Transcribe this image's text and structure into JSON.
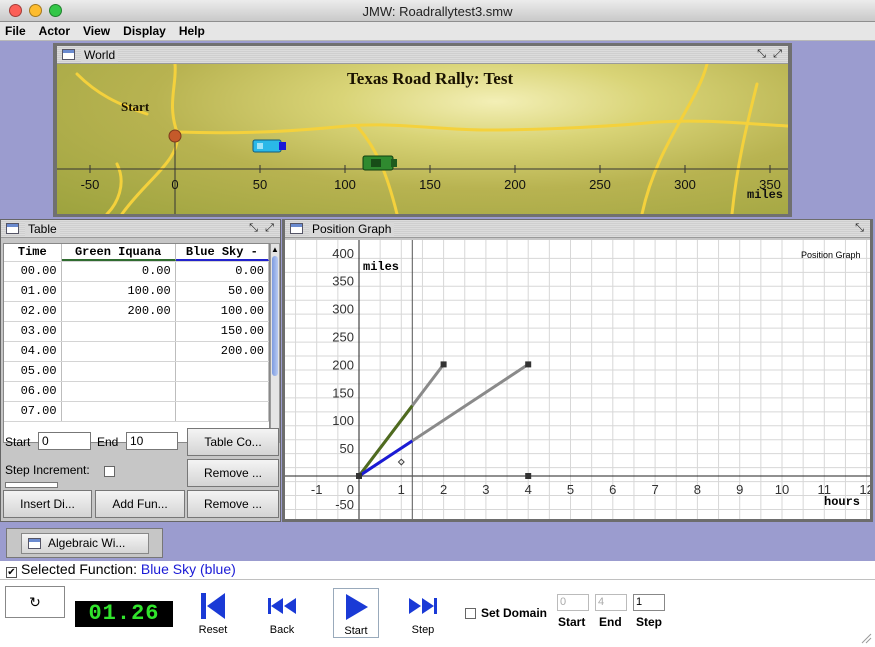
{
  "window": {
    "title": "JMW: Roadrallytest3.smw",
    "light_colors": [
      "#fc5f57",
      "#fdbc2e",
      "#33c748"
    ]
  },
  "menu": [
    "File",
    "Actor",
    "View",
    "Display",
    "Help"
  ],
  "world": {
    "frame_title": "World",
    "map_title": "Texas Road Rally: Test",
    "start_label": "Start",
    "axis_ticks": [
      "-50",
      "0",
      "50",
      "100",
      "150",
      "200",
      "250",
      "300",
      "350"
    ],
    "axis_unit": "miles"
  },
  "table": {
    "frame_title": "Table",
    "headers": [
      "Time",
      "Green Iquana",
      "Blue Sky -"
    ],
    "rows": [
      [
        "00.00",
        "0.00",
        "0.00"
      ],
      [
        "01.00",
        "100.00",
        "50.00"
      ],
      [
        "02.00",
        "200.00",
        "100.00"
      ],
      [
        "03.00",
        "",
        "150.00"
      ],
      [
        "04.00",
        "",
        "200.00"
      ],
      [
        "05.00",
        "",
        ""
      ],
      [
        "06.00",
        "",
        ""
      ],
      [
        "07.00",
        "",
        ""
      ]
    ],
    "start_label": "Start",
    "start_value": "0",
    "end_label": "End",
    "end_value": "10",
    "step_label": "Step Increment:",
    "btn_table_co": "Table Co...",
    "btn_remove1": "Remove ...",
    "btn_remove2": "Remove ...",
    "btn_insert": "Insert Di...",
    "btn_addfun": "Add Fun..."
  },
  "graph": {
    "frame_title": "Position Graph",
    "corner_label": "Position Graph",
    "y_unit": "miles",
    "x_unit": "hours",
    "x_ticks": [
      "-1",
      "1",
      "2",
      "3",
      "4",
      "5",
      "6",
      "7",
      "8",
      "9",
      "10",
      "11",
      "12"
    ],
    "y_ticks": [
      "400",
      "350",
      "300",
      "250",
      "200",
      "150",
      "100",
      "50",
      "-50"
    ],
    "zero_label": "0",
    "colors": {
      "green": "#4f6b1f",
      "blue": "#1a1ad6",
      "gray": "#8a8a8a"
    }
  },
  "chart_data": {
    "type": "line",
    "title": "Position Graph",
    "xlabel": "hours",
    "ylabel": "miles",
    "xlim": [
      -1.5,
      12.3
    ],
    "ylim": [
      -65,
      410
    ],
    "current_time": 1.26,
    "series": [
      {
        "name": "Green Iquana",
        "x": [
          0,
          2
        ],
        "y": [
          0,
          200
        ]
      },
      {
        "name": "Blue Sky",
        "x": [
          0,
          4
        ],
        "y": [
          0,
          200
        ]
      }
    ]
  },
  "algebraic": {
    "label": "Algebraic Wi..."
  },
  "selected_function": {
    "prefix": "Selected Function: ",
    "name": "Blue Sky (blue)"
  },
  "controls": {
    "clock": "01.26",
    "reset": "Reset",
    "back": "Back",
    "start": "Start",
    "step": "Step",
    "set_domain": "Set Domain",
    "domain_start": "0",
    "domain_end": "4",
    "domain_step": "1",
    "start_label": "Start",
    "end_label": "End",
    "step_label": "Step"
  }
}
